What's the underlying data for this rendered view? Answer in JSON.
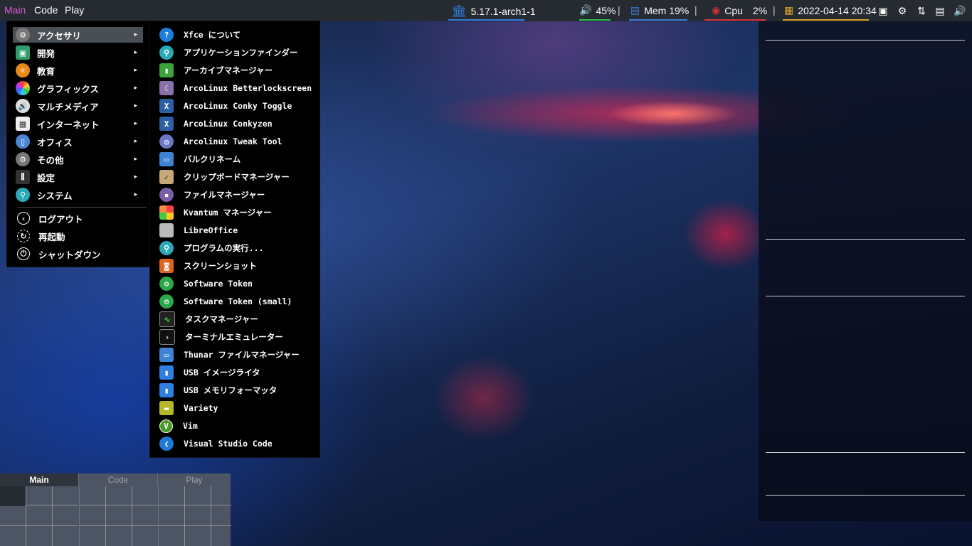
{
  "topbar": {
    "workspaces": [
      "Main",
      "Code",
      "Play"
    ],
    "active_workspace": "Main",
    "kernel": "5.17.1-arch1-1",
    "volume": "45%",
    "mem": "Mem 19%",
    "cpu_label": "Cpu",
    "cpu_value": "2%",
    "datetime": "2022-04-14 20:34",
    "separator": "|",
    "colors": {
      "workspace_active": "#d65bd6",
      "kernel": "#2f7fe0",
      "volume": "#2fbf4f",
      "mem": "#3a7fd8",
      "cpu": "#d6313d",
      "date": "#d7a227"
    }
  },
  "main_menu": {
    "items": [
      {
        "label": "アクセサリ",
        "icon": "accessories-icon",
        "submenu": true,
        "active": true
      },
      {
        "label": "開発",
        "icon": "development-icon",
        "submenu": true
      },
      {
        "label": "教育",
        "icon": "education-icon",
        "submenu": true
      },
      {
        "label": "グラフィックス",
        "icon": "graphics-icon",
        "submenu": true
      },
      {
        "label": "マルチメディア",
        "icon": "multimedia-icon",
        "submenu": true
      },
      {
        "label": "インターネット",
        "icon": "internet-icon",
        "submenu": true
      },
      {
        "label": "オフィス",
        "icon": "office-icon",
        "submenu": true
      },
      {
        "label": "その他",
        "icon": "other-icon",
        "submenu": true
      },
      {
        "label": "設定",
        "icon": "settings-icon",
        "submenu": true
      },
      {
        "label": "システム",
        "icon": "system-icon",
        "submenu": true
      }
    ],
    "actions": [
      {
        "label": "ログアウト",
        "icon": "logout-icon"
      },
      {
        "label": "再起動",
        "icon": "restart-icon"
      },
      {
        "label": "シャットダウン",
        "icon": "shutdown-icon"
      }
    ],
    "arrow": "▸"
  },
  "sub_menu": {
    "items": [
      {
        "label": "Xfce について",
        "icon": "help-icon"
      },
      {
        "label": "アプリケーションファインダー",
        "icon": "app-finder-icon"
      },
      {
        "label": "アーカイブマネージャー",
        "icon": "archive-icon"
      },
      {
        "label": "ArcoLinux Betterlockscreen",
        "icon": "lock-screen-icon"
      },
      {
        "label": "ArcoLinux Conky Toggle",
        "icon": "conky-icon"
      },
      {
        "label": "ArcoLinux Conkyzen",
        "icon": "conkyzen-icon"
      },
      {
        "label": "Arcolinux Tweak Tool",
        "icon": "tweak-tool-icon"
      },
      {
        "label": "バルクリネーム",
        "icon": "bulk-rename-icon"
      },
      {
        "label": "クリップボードマネージャー",
        "icon": "clipboard-icon"
      },
      {
        "label": "ファイルマネージャー",
        "icon": "file-manager-icon"
      },
      {
        "label": "Kvantum マネージャー",
        "icon": "kvantum-icon"
      },
      {
        "label": "LibreOffice",
        "icon": "libreoffice-icon"
      },
      {
        "label": "プログラムの実行...",
        "icon": "run-program-icon"
      },
      {
        "label": "スクリーンショット",
        "icon": "screenshot-icon"
      },
      {
        "label": "Software Token",
        "icon": "token-icon"
      },
      {
        "label": "Software Token (small)",
        "icon": "token-small-icon"
      },
      {
        "label": "タスクマネージャー",
        "icon": "task-manager-icon"
      },
      {
        "label": "ターミナルエミュレーター",
        "icon": "terminal-icon"
      },
      {
        "label": "Thunar ファイルマネージャー",
        "icon": "thunar-icon"
      },
      {
        "label": "USB イメージライタ",
        "icon": "usb-writer-icon"
      },
      {
        "label": "USB メモリフォーマッタ",
        "icon": "usb-format-icon"
      },
      {
        "label": "Variety",
        "icon": "variety-icon"
      },
      {
        "label": "Vim",
        "icon": "vim-icon"
      },
      {
        "label": "Visual Studio Code",
        "icon": "vscode-icon"
      }
    ]
  },
  "pager": {
    "workspaces": [
      "Main",
      "Code",
      "Play"
    ],
    "active": "Main"
  }
}
